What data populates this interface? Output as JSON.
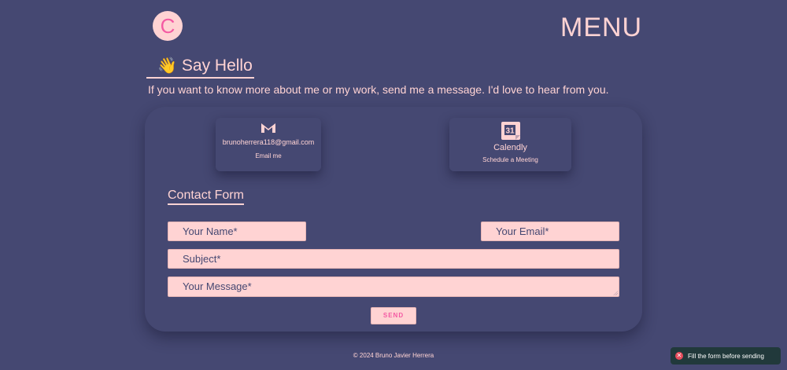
{
  "header": {
    "logo_letter": "C",
    "menu_label": "MENU"
  },
  "hello": {
    "emoji": "👋",
    "title": "Say Hello",
    "intro": "If you want to know more about me or my work, send me a message. I'd love to hear from you."
  },
  "contacts": {
    "gmail": {
      "icon": "gmail-icon",
      "email": "brunoherrera118@gmail.com",
      "label": "Email me"
    },
    "calendly": {
      "icon": "calendar-icon",
      "calendar_day": "31",
      "title": "Calendly",
      "label": "Schedule a Meeting"
    }
  },
  "form": {
    "title": "Contact Form",
    "name_placeholder": "Your Name*",
    "email_placeholder": "Your Email*",
    "subject_placeholder": "Subject*",
    "message_placeholder": "Your Message*",
    "send_label": "SEND"
  },
  "footer": {
    "text": "© 2024 Bruno Javier Herrera"
  },
  "toast": {
    "icon": "error-icon",
    "message": "Fill the form before sending"
  },
  "colors": {
    "background": "#454872",
    "accent": "#ffd3d3",
    "brand_pink": "#f45aa3",
    "toast_bg": "#21393b",
    "error_red": "#e74c5c"
  }
}
